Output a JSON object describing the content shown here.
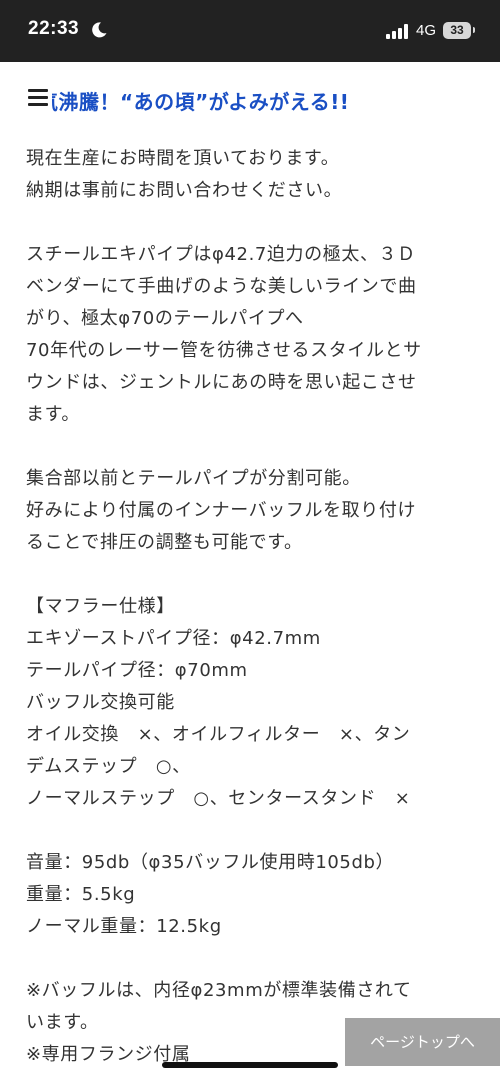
{
  "status_bar": {
    "time": "22:33",
    "network": "4G",
    "battery": "33"
  },
  "header": {
    "title_clipped": "氣沸騰！",
    "title_rest": "“あの頃”がよみがえる!!"
  },
  "content": {
    "lines": [
      "現在生産にお時間を頂いております。",
      "納期は事前にお問い合わせください。",
      "",
      "スチールエキパイプはφ42.7迫力の極太、３Ｄ",
      "ベンダーにて手曲げのような美しいラインで曲",
      "がり、極太φ70のテールパイプへ",
      "70年代のレーサー管を彷彿させるスタイルとサ",
      "ウンドは、ジェントルにあの時を思い起こさせ",
      "ます。",
      "",
      "集合部以前とテールパイプが分割可能。",
      "好みにより付属のインナーバッフルを取り付け",
      "ることで排圧の調整も可能です。",
      "",
      "【マフラー仕様】",
      "エキゾーストパイプ径：φ42.7mm",
      "テールパイプ径：φ70mm",
      "バッフル交換可能",
      "オイル交換　×、オイルフィルター　×、タン",
      "デムステップ　○、",
      "ノーマルステップ　○、センタースタンド　×",
      "",
      "音量：95db（φ35バッフル使用時105db）",
      "重量：5.5kg",
      "ノーマル重量：12.5kg",
      "",
      "※バッフルは、内径φ23mmが標準装備されて",
      "います。",
      "※専用フランジ付属"
    ]
  },
  "page_top_button": {
    "label": "ページトップへ"
  },
  "colors": {
    "status_bar_bg": "#222222",
    "title_blue": "#1a4fc4",
    "body_text": "#333333",
    "page_top_bg": "#a3a3a3"
  }
}
